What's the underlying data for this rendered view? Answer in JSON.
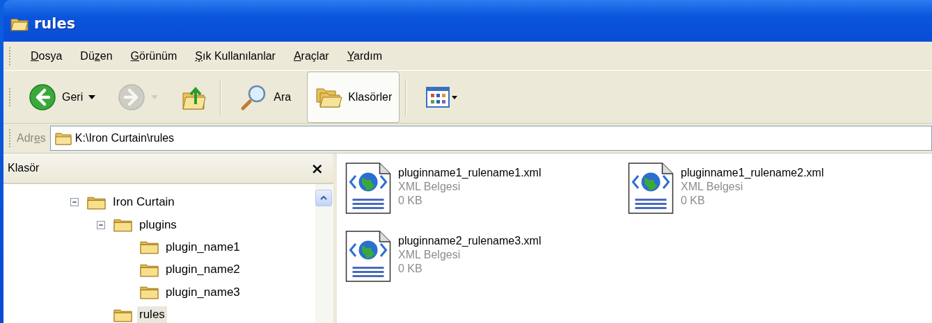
{
  "window": {
    "title": "rules"
  },
  "menu": [
    {
      "key": "D",
      "post": "osya"
    },
    {
      "pre": "Dü",
      "key": "z",
      "post": "en"
    },
    {
      "key": "G",
      "post": "örünüm"
    },
    {
      "key": "Ş",
      "post": "ık Kullanılanlar"
    },
    {
      "key": "A",
      "post": "raçlar"
    },
    {
      "key": "Y",
      "post": "ardım"
    }
  ],
  "toolbar": [
    {
      "kind": "back",
      "label": "Geri",
      "disabled": false,
      "pressed": false
    },
    {
      "kind": "forward",
      "disabled": true,
      "pressed": false
    },
    {
      "kind": "up",
      "disabled": false,
      "pressed": false
    },
    {
      "kind": "search",
      "label": "Ara",
      "disabled": false,
      "pressed": false
    },
    {
      "kind": "folders",
      "label": "Klasörler",
      "disabled": false,
      "pressed": true
    },
    {
      "kind": "views",
      "disabled": false,
      "pressed": false
    }
  ],
  "address": {
    "label_pre": "Adr",
    "label_key": "e",
    "label_post": "s",
    "value": "K:\\Iron Curtain\\rules"
  },
  "folder_pane": {
    "title": "Klasör",
    "close": "×",
    "tree": [
      {
        "name": "Iron Curtain",
        "expanded": true,
        "selected": false,
        "children": [
          {
            "name": "plugins",
            "expanded": true,
            "selected": false,
            "children": [
              {
                "name": "plugin_name1",
                "selected": false
              },
              {
                "name": "plugin_name2",
                "selected": false
              },
              {
                "name": "plugin_name3",
                "selected": false
              }
            ]
          },
          {
            "name": "rules",
            "selected": true
          }
        ]
      }
    ]
  },
  "files": [
    {
      "name": "pluginname1_rulename1.xml",
      "type": "XML Belgesi",
      "size": "0 KB"
    },
    {
      "name": "pluginname1_rulename2.xml",
      "type": "XML Belgesi",
      "size": "0 KB"
    },
    {
      "name": "pluginname2_rulename3.xml",
      "type": "XML Belgesi",
      "size": "0 KB"
    }
  ]
}
